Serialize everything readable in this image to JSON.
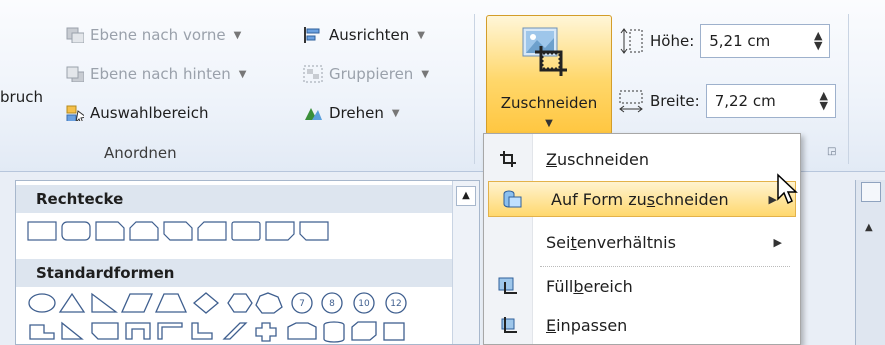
{
  "ribbon": {
    "left_cut_label": "bruch",
    "arrange": {
      "group_label": "Anordnen",
      "bring_forward": "Ebene nach vorne",
      "send_backward": "Ebene nach hinten",
      "selection_pane": "Auswahlbereich",
      "align": "Ausrichten",
      "group": "Gruppieren",
      "rotate": "Drehen"
    },
    "crop_button": {
      "label_a": "Zusch",
      "label_b": "neiden",
      "label": "Zuschneiden"
    },
    "size": {
      "height_label": "Höhe:",
      "height_value": "5,21 cm",
      "width_label": "Breite:",
      "width_value": "7,22 cm"
    }
  },
  "shapes_gallery": {
    "rect_header": "Rechtecke",
    "basic_header": "Standardformen",
    "numbered_badges": [
      "7",
      "8",
      "10",
      "12"
    ]
  },
  "crop_menu": {
    "items": [
      {
        "label": "Zuschneiden",
        "mnemonic_before": "",
        "mnemonic": "Z",
        "mnemonic_after": "uschneiden"
      },
      {
        "label": "Auf Form zuschneiden",
        "mnemonic_before": "Auf Form zu",
        "mnemonic": "s",
        "mnemonic_after": "chneiden"
      },
      {
        "label": "Seitenverhältnis",
        "mnemonic_before": "Sei",
        "mnemonic": "t",
        "mnemonic_after": "enverhältnis"
      },
      {
        "label": "Füllbereich",
        "mnemonic_before": "Füll",
        "mnemonic": "b",
        "mnemonic_after": "ereich"
      },
      {
        "label": "Einpassen",
        "mnemonic_before": "",
        "mnemonic": "E",
        "mnemonic_after": "inpassen"
      }
    ]
  },
  "colors": {
    "highlight": "#ffd86e",
    "ribbon_bg": "#eef3fa",
    "border": "#a7b7cc"
  }
}
